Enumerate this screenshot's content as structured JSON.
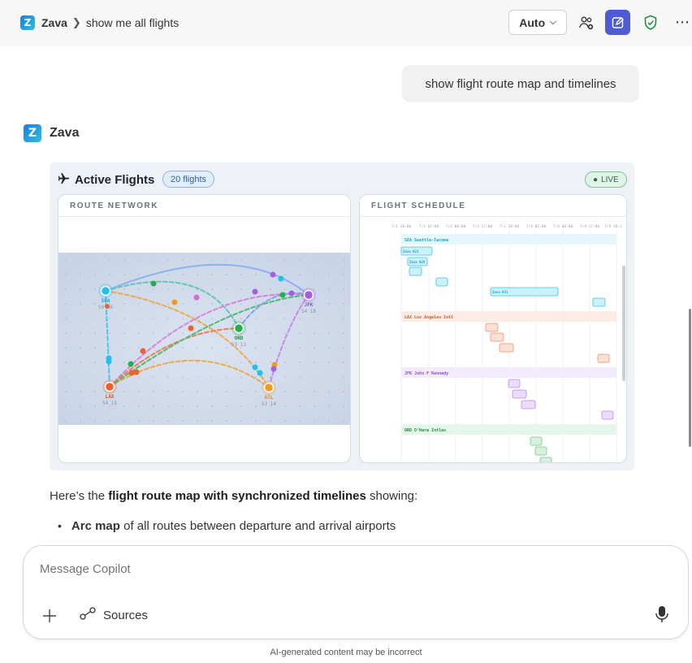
{
  "header": {
    "app_name": "Zava",
    "breadcrumb_chat": "show me all flights",
    "model_select": "Auto",
    "icons": [
      "people-add-icon",
      "compose-icon",
      "shield-check-icon",
      "more-icon"
    ]
  },
  "messages": {
    "user_prompt": "show flight route map and timelines",
    "assistant_name": "Zava"
  },
  "card": {
    "title": "Active Flights",
    "flight_count": "20 flights",
    "live_label": "LIVE",
    "route_panel_title": "ROUTE NETWORK",
    "schedule_panel_title": "FLIGHT SCHEDULE",
    "airports": [
      {
        "code": "SEA",
        "sub": "59 16",
        "color": "#1ec0ef"
      },
      {
        "code": "JFK",
        "sub": "54 18",
        "color": "#a45ee6"
      },
      {
        "code": "ORD",
        "sub": "13 13",
        "color": "#22b04c"
      },
      {
        "code": "LAX",
        "sub": "54 15",
        "color": "#f0602a"
      },
      {
        "code": "ATL",
        "sub": "52 14",
        "color": "#f29b1b"
      }
    ],
    "schedule_ticks": [
      "7/1 20:00",
      "7/2 02:00",
      "7/2 08:00",
      "7/2 17:00",
      "7/2 20:00",
      "7/4 02:00",
      "7/4 08:00",
      "7/4 17:00",
      "7/4 20:1"
    ],
    "schedule_groups": [
      {
        "label": "SEA Seattle-Tacoma",
        "color": "#14b6e0",
        "flights": [
          "Zava 923",
          "Zava 928",
          "",
          "",
          "Zava 931",
          ""
        ]
      },
      {
        "label": "LAX Los Angeles Intl",
        "color": "#f0602a",
        "flights": [
          "",
          "",
          "",
          ""
        ]
      },
      {
        "label": "JFK John F Kennedy",
        "color": "#a45ee6",
        "flights": [
          "",
          "",
          "",
          ""
        ]
      },
      {
        "label": "ORD O'Hare Intles",
        "color": "#22b04c",
        "flights": [
          "",
          "",
          ""
        ]
      }
    ]
  },
  "response": {
    "intro_prefix": "Here’s the ",
    "intro_bold": "flight route map with synchronized timelines",
    "intro_suffix": " showing:",
    "bullet_bold": "Arc map",
    "bullet_rest": " of all routes between departure and arrival airports"
  },
  "composer": {
    "placeholder": "Message Copilot",
    "sources_label": "Sources"
  },
  "footer_note": "AI-generated content may be incorrect"
}
